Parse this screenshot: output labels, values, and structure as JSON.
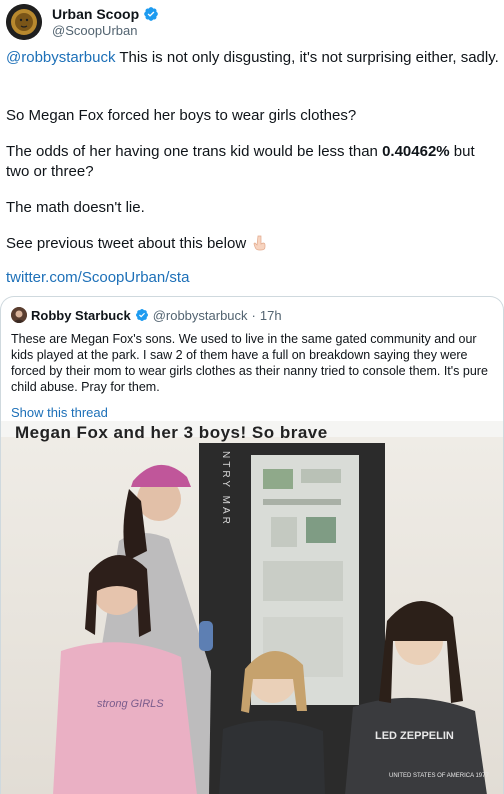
{
  "tweet": {
    "author_name": "Urban Scoop",
    "author_handle": "@ScoopUrban",
    "mention": "@robbystarbuck",
    "para1_rest": " This is not only disgusting, it's not surprising either, sadly.",
    "para2": "So Megan Fox forced her boys to wear girls clothes?",
    "para3_pre": "The odds of her having one trans kid would be less than ",
    "para3_bold": "0.40462%",
    "para3_post": " but two or three?",
    "para4": "The math doesn't lie.",
    "para5": "See previous tweet about this below",
    "link": "twitter.com/ScoopUrban/sta"
  },
  "quote": {
    "author_name": "Robby Starbuck",
    "author_handle": "@robbystarbuck",
    "separator": "·",
    "time": "17h",
    "text": "These are Megan Fox's sons. We used to live in the same gated community and our kids played at the park. I saw 2 of them have a full on breakdown saying they were forced by their mom to wear girls clothes as their nanny tried to console them. It's pure child abuse. Pray for them.",
    "show_thread": "Show this thread",
    "photo_caption": "Megan Fox and her 3 boys! So brave",
    "sign_text": "NTRY MAR",
    "shirt_left": "strong GIRLS",
    "shirt_right": "LED ZEPPELIN",
    "shirt_right_sub": "UNITED STATES OF AMERICA 1977"
  },
  "colors": {
    "verified": "#1d9bf0",
    "link": "#1d70b8",
    "secondary_text": "#536471",
    "border": "#cfd9de"
  },
  "icons": {
    "verified": "verified-badge-icon",
    "pointing": "pointing-down-icon"
  }
}
